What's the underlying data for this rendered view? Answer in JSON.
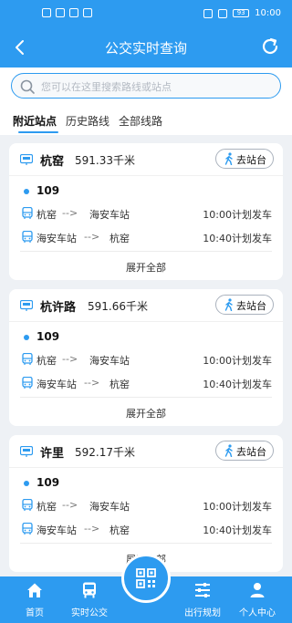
{
  "status_bar": {
    "time": "10:00",
    "battery": "93"
  },
  "header": {
    "title": "公交实时查询"
  },
  "search": {
    "placeholder": "您可以在这里搜索路线或站点"
  },
  "tabs": [
    {
      "label": "附近站点",
      "active": true
    },
    {
      "label": "历史路线",
      "active": false
    },
    {
      "label": "全部线路",
      "active": false
    }
  ],
  "stops": [
    {
      "name": "杭窑",
      "distance": "591.33千米",
      "go_label": "去站台",
      "route": "109",
      "directions": [
        {
          "from": "杭窑",
          "arrow": "-->",
          "to": "海安车站",
          "departure": "10:00计划发车"
        },
        {
          "from": "海安车站",
          "arrow": "-->",
          "to": "杭窑",
          "departure": "10:40计划发车"
        }
      ],
      "expand_label": "展开全部"
    },
    {
      "name": "杭许路",
      "distance": "591.66千米",
      "go_label": "去站台",
      "route": "109",
      "directions": [
        {
          "from": "杭窑",
          "arrow": "-->",
          "to": "海安车站",
          "departure": "10:00计划发车"
        },
        {
          "from": "海安车站",
          "arrow": "-->",
          "to": "杭窑",
          "departure": "10:40计划发车"
        }
      ],
      "expand_label": "展开全部"
    },
    {
      "name": "许里",
      "distance": "592.17千米",
      "go_label": "去站台",
      "route": "109",
      "directions": [
        {
          "from": "杭窑",
          "arrow": "-->",
          "to": "海安车站",
          "departure": "10:00计划发车"
        },
        {
          "from": "海安车站",
          "arrow": "-->",
          "to": "杭窑",
          "departure": "10:40计划发车"
        }
      ],
      "expand_label": "展开全部"
    }
  ],
  "bottom_nav": [
    {
      "label": "首页",
      "icon": "home-icon"
    },
    {
      "label": "实时公交",
      "icon": "bus-icon"
    },
    {
      "label": "",
      "icon": "qr-scan-icon"
    },
    {
      "label": "出行规划",
      "icon": "sliders-icon"
    },
    {
      "label": "个人中心",
      "icon": "user-icon"
    }
  ],
  "colors": {
    "accent": "#2d9bf0",
    "background": "#eef1f5"
  }
}
